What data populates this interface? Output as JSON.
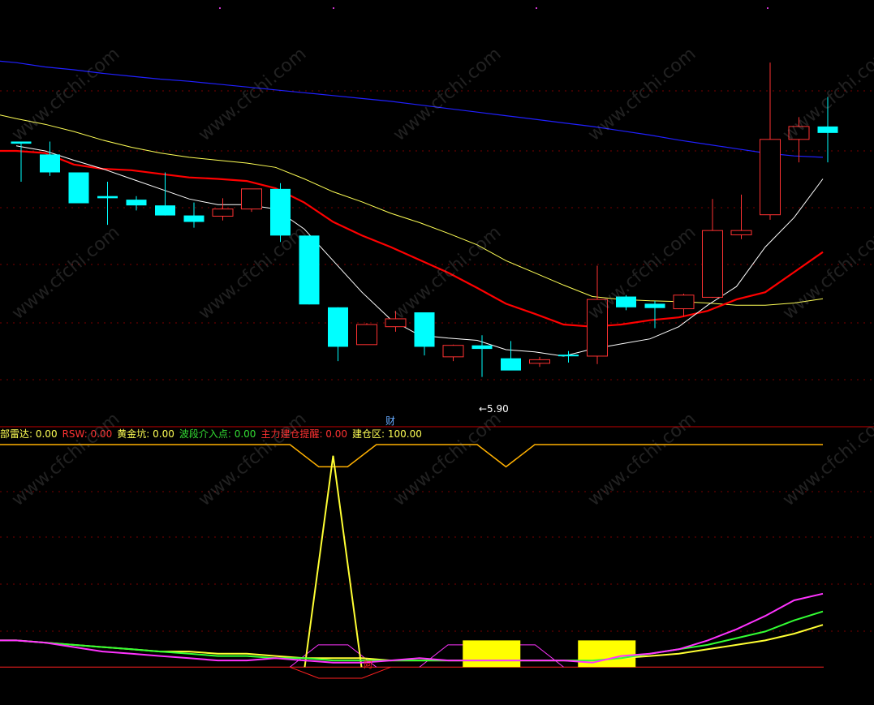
{
  "watermark": "www.cfchi.com",
  "chart_data": [
    {
      "type": "candlestick",
      "panel": "price",
      "ylim": [
        5.5,
        10.7
      ],
      "low_annotation": "←5.90",
      "marker_label": "财",
      "colors": {
        "up": "#ff3232",
        "down": "#00ffff",
        "ma_fast": "#ffffff",
        "ma_mid": "#ff0000",
        "ma_slow": "#ffff55",
        "ma_long": "#2020ff"
      },
      "candles": [
        {
          "o": 9.18,
          "h": 9.18,
          "l": 8.62,
          "c": 9.15
        },
        {
          "o": 9.0,
          "h": 9.18,
          "l": 8.7,
          "c": 8.75
        },
        {
          "o": 8.75,
          "h": 8.75,
          "l": 8.32,
          "c": 8.32
        },
        {
          "o": 8.42,
          "h": 8.62,
          "l": 8.02,
          "c": 8.39
        },
        {
          "o": 8.37,
          "h": 8.42,
          "l": 8.22,
          "c": 8.29
        },
        {
          "o": 8.29,
          "h": 8.75,
          "l": 8.15,
          "c": 8.15
        },
        {
          "o": 8.15,
          "h": 8.33,
          "l": 7.98,
          "c": 8.06
        },
        {
          "o": 8.14,
          "h": 8.39,
          "l": 8.08,
          "c": 8.24
        },
        {
          "o": 8.24,
          "h": 8.52,
          "l": 8.2,
          "c": 8.52
        },
        {
          "o": 8.52,
          "h": 8.6,
          "l": 7.78,
          "c": 7.87
        },
        {
          "o": 7.87,
          "h": 7.87,
          "l": 6.91,
          "c": 6.91
        },
        {
          "o": 6.87,
          "h": 6.87,
          "l": 6.12,
          "c": 6.32
        },
        {
          "o": 6.35,
          "h": 6.65,
          "l": 6.37,
          "c": 6.63
        },
        {
          "o": 6.6,
          "h": 6.82,
          "l": 6.53,
          "c": 6.71
        },
        {
          "o": 6.8,
          "h": 6.8,
          "l": 6.2,
          "c": 6.32
        },
        {
          "o": 6.18,
          "h": 6.35,
          "l": 6.12,
          "c": 6.34
        },
        {
          "o": 6.34,
          "h": 6.48,
          "l": 5.9,
          "c": 6.29
        },
        {
          "o": 6.16,
          "h": 6.4,
          "l": 6.0,
          "c": 5.99
        },
        {
          "o": 6.09,
          "h": 6.18,
          "l": 6.04,
          "c": 6.14
        },
        {
          "o": 6.21,
          "h": 6.26,
          "l": 6.1,
          "c": 6.19
        },
        {
          "o": 6.19,
          "h": 7.45,
          "l": 6.08,
          "c": 6.98
        },
        {
          "o": 7.02,
          "h": 7.04,
          "l": 6.83,
          "c": 6.87
        },
        {
          "o": 6.92,
          "h": 6.96,
          "l": 6.58,
          "c": 6.86
        },
        {
          "o": 6.85,
          "h": 7.06,
          "l": 6.74,
          "c": 7.04
        },
        {
          "o": 7.01,
          "h": 8.38,
          "l": 7.0,
          "c": 7.94
        },
        {
          "o": 7.88,
          "h": 8.44,
          "l": 7.82,
          "c": 7.94
        },
        {
          "o": 8.16,
          "h": 10.28,
          "l": 8.09,
          "c": 9.21
        },
        {
          "o": 9.21,
          "h": 9.52,
          "l": 8.89,
          "c": 9.39
        },
        {
          "o": 9.39,
          "h": 9.8,
          "l": 8.89,
          "c": 9.3
        }
      ],
      "ma_fast": [
        9.12,
        9.05,
        8.92,
        8.8,
        8.66,
        8.52,
        8.38,
        8.3,
        8.3,
        8.24,
        7.96,
        7.52,
        7.08,
        6.7,
        6.48,
        6.44,
        6.41,
        6.28,
        6.25,
        6.19,
        6.29,
        6.36,
        6.43,
        6.6,
        6.9,
        7.16,
        7.71,
        8.12,
        8.66
      ],
      "ma_mid": [
        9.05,
        9.02,
        8.86,
        8.8,
        8.78,
        8.73,
        8.68,
        8.66,
        8.63,
        8.53,
        8.33,
        8.06,
        7.87,
        7.71,
        7.53,
        7.35,
        7.14,
        6.92,
        6.78,
        6.63,
        6.6,
        6.63,
        6.69,
        6.73,
        6.82,
        6.98,
        7.08,
        7.36,
        7.64
      ],
      "ma_slow": [
        9.5,
        9.42,
        9.32,
        9.2,
        9.1,
        9.02,
        8.96,
        8.92,
        8.88,
        8.82,
        8.66,
        8.48,
        8.34,
        8.18,
        8.05,
        7.9,
        7.74,
        7.52,
        7.35,
        7.18,
        7.02,
        6.98,
        6.96,
        6.95,
        6.93,
        6.9,
        6.9,
        6.93,
        6.99
      ],
      "ma_long": [
        10.28,
        10.22,
        10.18,
        10.13,
        10.09,
        10.05,
        10.02,
        9.98,
        9.94,
        9.9,
        9.86,
        9.82,
        9.78,
        9.74,
        9.69,
        9.64,
        9.59,
        9.54,
        9.49,
        9.44,
        9.39,
        9.33,
        9.27,
        9.2,
        9.14,
        9.08,
        9.02,
        8.98,
        8.96
      ]
    },
    {
      "type": "indicator",
      "panel": "indicator",
      "ylim": [
        -5,
        100
      ],
      "legend": [
        {
          "name": "部雷达",
          "value": "0.00",
          "color": "#ffff55"
        },
        {
          "name": "RSW",
          "value": "0.00",
          "color": "#ff3232"
        },
        {
          "name": "黄金坑",
          "value": "0.00",
          "color": "#ffff55"
        },
        {
          "name": "波段介入点",
          "value": "0.00",
          "color": "#33dd33"
        },
        {
          "name": "主力建仓提醒",
          "value": "0.00",
          "color": "#ff3232"
        },
        {
          "name": "建仓区",
          "value": "100.00",
          "color": "#ffff55"
        }
      ],
      "colors": {
        "top_line": "#ffb000",
        "magenta": "#ff33ff",
        "green": "#33ff33",
        "yellow": "#ffff33",
        "base": "#ff2020",
        "bar": "#ffff00",
        "spike": "#ffff33",
        "marker": "#ff2020"
      },
      "marker_label": "阿",
      "top_line": [
        {
          "x": 0,
          "y": 100
        },
        {
          "x": 9.5,
          "y": 100
        },
        {
          "x": 10.5,
          "y": 90
        },
        {
          "x": 11.5,
          "y": 90
        },
        {
          "x": 12.5,
          "y": 100
        },
        {
          "x": 16,
          "y": 100
        },
        {
          "x": 17,
          "y": 90
        },
        {
          "x": 18,
          "y": 100
        },
        {
          "x": 28,
          "y": 100
        }
      ],
      "magenta": [
        12,
        11,
        9,
        7,
        6,
        5,
        4,
        3,
        3,
        4,
        3,
        2,
        2,
        3,
        4,
        3,
        3,
        3,
        3,
        3,
        2,
        5,
        6,
        8,
        12,
        17,
        23,
        30,
        33
      ],
      "green": [
        12,
        11,
        10,
        9,
        8,
        7,
        6,
        5,
        5,
        4,
        4,
        3,
        3,
        3,
        3,
        3,
        3,
        3,
        3,
        3,
        3,
        4,
        6,
        8,
        10,
        13,
        16,
        21,
        25
      ],
      "yellow": [
        12,
        11,
        10,
        9,
        8,
        7,
        7,
        6,
        6,
        5,
        4,
        4,
        4,
        3,
        3,
        3,
        3,
        3,
        3,
        3,
        3,
        4,
        5,
        6,
        8,
        10,
        12,
        15,
        19
      ],
      "spike": {
        "x": 11,
        "peak": 95
      },
      "bars": [
        {
          "from": 15.5,
          "to": 17.5,
          "y": 12
        },
        {
          "from": 19.5,
          "to": 21.5,
          "y": 12
        }
      ],
      "bands": [
        {
          "from": 9.5,
          "to": 12.5,
          "y": 10
        },
        {
          "from": 14,
          "to": 19,
          "y": 10
        }
      ]
    }
  ]
}
